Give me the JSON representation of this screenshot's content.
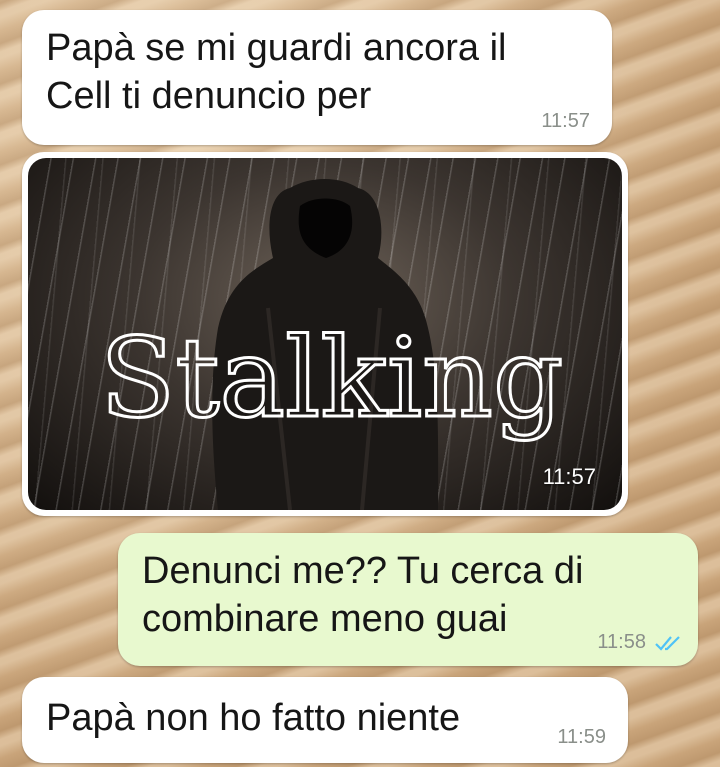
{
  "messages": [
    {
      "id": "m1",
      "direction": "incoming",
      "text_line1": "Papà se mi guardi ancora il",
      "text_line2": "Cell ti denuncio per",
      "time": "11:57"
    },
    {
      "id": "m2",
      "direction": "incoming",
      "type": "image",
      "image_text": "Stalking",
      "time": "11:57"
    },
    {
      "id": "m3",
      "direction": "outgoing",
      "text_line1": "Denunci me?? Tu cerca di",
      "text_line2": "combinare meno guai",
      "time": "11:58",
      "status": "read"
    },
    {
      "id": "m4",
      "direction": "incoming",
      "text_line1": "Papà non ho fatto niente",
      "time": "11:59"
    }
  ],
  "colors": {
    "incoming_bubble": "#ffffff",
    "outgoing_bubble": "#e8f9cf",
    "read_ticks": "#4fc3f7"
  },
  "icons": {
    "read_receipt": "double-check-icon"
  }
}
